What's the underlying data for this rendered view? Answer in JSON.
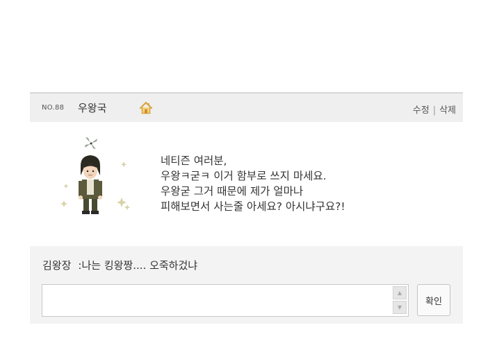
{
  "post": {
    "number": "NO.88",
    "author": "우왕국",
    "actions": {
      "edit": "수정",
      "separator": "|",
      "delete": "삭제"
    },
    "home_icon": "home-icon",
    "body_lines": [
      "네티즌 여러분,",
      "우왕ㅋ굳ㅋ 이거 함부로 쓰지 마세요.",
      "우왕굳 그거 때문에 제가 얼마나",
      "피해보면서 사는줄 아세요? 아시냐구요?!"
    ]
  },
  "comments": [
    {
      "author": "김왕장",
      "text": ":나는 킹왕짱.... 오죽하겄냐"
    }
  ],
  "comment_form": {
    "value": "",
    "placeholder": "",
    "submit_label": "확인"
  },
  "colors": {
    "header_bg": "#efefef",
    "comment_bg": "#f3f3f3",
    "text": "#333333",
    "home_icon": "#e3b04b"
  }
}
